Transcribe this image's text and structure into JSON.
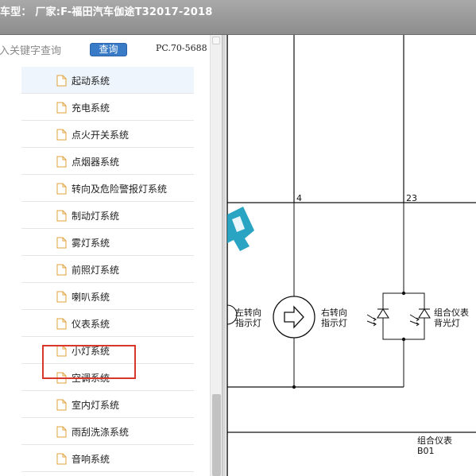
{
  "window": {
    "title": "车型： 厂家:F-福田汽车伽途T32017-2018"
  },
  "search": {
    "placeholder": "输入关键字查询",
    "button_label": "查询",
    "code": "PC.70-5688"
  },
  "systems": [
    "起动系统",
    "充电系统",
    "点火开关系统",
    "点烟器系统",
    "转向及危险警报灯系统",
    "制动灯系统",
    "雾灯系统",
    "前照灯系统",
    "喇叭系统",
    "仪表系统",
    "小灯系统",
    "空调系统",
    "室内灯系统",
    "雨刮洗涤系统",
    "音响系统"
  ],
  "selected_index": 0,
  "highlighted_index": 9,
  "diagram": {
    "pin_left": "4",
    "pin_right": "23",
    "left_turn": [
      "左转向",
      "指示灯"
    ],
    "right_turn": [
      "右转向",
      "指示灯"
    ],
    "cluster_backlight": [
      "组合仪表",
      "背光灯"
    ],
    "module_name": "组合仪表",
    "module_code": "B01"
  },
  "colors": {
    "titlebar": "#999999",
    "button": "#3a7bc8",
    "highlight": "#d9362c",
    "selection": "#eef5fc",
    "watermark": "#1e9fc0"
  }
}
